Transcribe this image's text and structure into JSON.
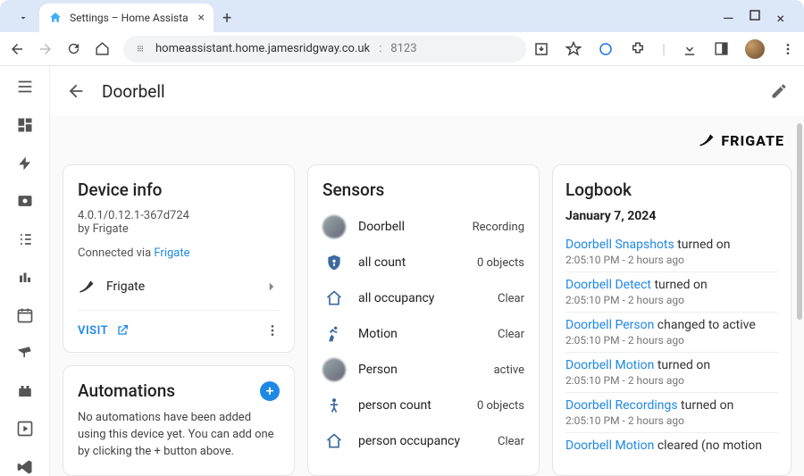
{
  "browser": {
    "tab_title": "Settings – Home Assista",
    "url_host": "homeassistant.home.jamesridgway.co.uk",
    "url_port": "8123"
  },
  "header": {
    "title": "Doorbell"
  },
  "brand": "FRIGATE",
  "device_info": {
    "title": "Device info",
    "version": "4.0.1/0.12.1-367d724",
    "by_prefix": "by ",
    "by_name": "Frigate",
    "connected_prefix": "Connected via ",
    "connected_link": "Frigate",
    "integration_name": "Frigate",
    "visit_label": "VISIT"
  },
  "automations": {
    "title": "Automations",
    "text": "No automations have been added using this device yet. You can add one by clicking the + button above."
  },
  "sensors": {
    "title": "Sensors",
    "items": [
      {
        "name": "Doorbell",
        "status": "Recording",
        "icon": "blur"
      },
      {
        "name": "all count",
        "status": "0 objects",
        "icon": "shield"
      },
      {
        "name": "all occupancy",
        "status": "Clear",
        "icon": "home"
      },
      {
        "name": "Motion",
        "status": "Clear",
        "icon": "run"
      },
      {
        "name": "Person",
        "status": "active",
        "icon": "blur"
      },
      {
        "name": "person count",
        "status": "0 objects",
        "icon": "person"
      },
      {
        "name": "person occupancy",
        "status": "Clear",
        "icon": "home"
      }
    ]
  },
  "logbook": {
    "title": "Logbook",
    "date": "January 7, 2024",
    "entries": [
      {
        "link": "Doorbell Snapshots",
        "rest": " turned on",
        "time": "2:05:10 PM",
        "ago": "2 hours ago"
      },
      {
        "link": "Doorbell Detect",
        "rest": " turned on",
        "time": "2:05:10 PM",
        "ago": "2 hours ago"
      },
      {
        "link": "Doorbell Person",
        "rest": " changed to active",
        "time": "2:05:10 PM",
        "ago": "2 hours ago"
      },
      {
        "link": "Doorbell Motion",
        "rest": " turned on",
        "time": "2:05:10 PM",
        "ago": "2 hours ago"
      },
      {
        "link": "Doorbell Recordings",
        "rest": " turned on",
        "time": "2:05:10 PM",
        "ago": "2 hours ago"
      },
      {
        "link": "Doorbell Motion",
        "rest": " cleared (no motion",
        "time": "",
        "ago": ""
      }
    ]
  }
}
